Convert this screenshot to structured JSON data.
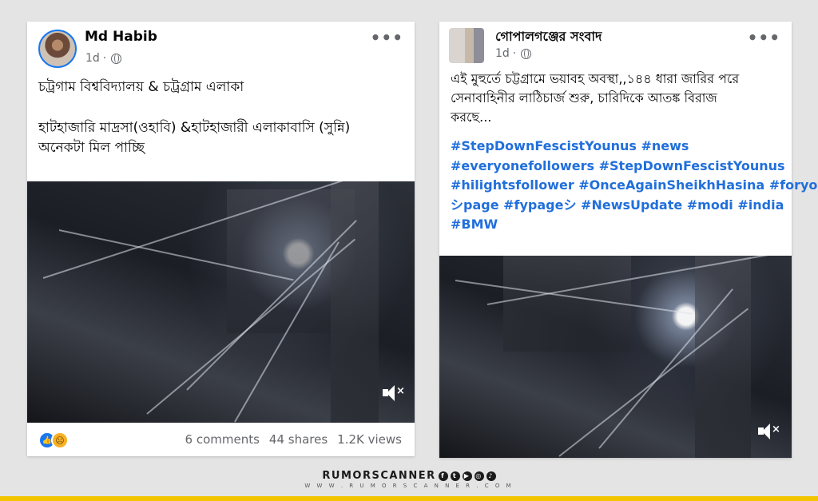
{
  "post1": {
    "author": "Md Habib",
    "time": "1d",
    "more": "•••",
    "text_lines": [
      "চট্রগাম বিশ্ববিদ্যালয় & চট্রগ্রাম এলাকা"
    ],
    "text_lines2": [
      "হাটহাজারি মাদ্রসা(ওহাবি) &হাটহাজারী এলাকাবাসি (সুন্নি)",
      "অনেকটা মিল পাচ্ছি"
    ],
    "comments": "6 comments",
    "shares": "44 shares",
    "views": "1.2K views"
  },
  "post2": {
    "author": "গোপালগঞ্জের সংবাদ",
    "time": "1d",
    "more": "•••",
    "text_lines": [
      "এই মুহুর্তে চট্টগ্রামে ভয়াবহ অবস্থা,,১৪৪ ধারা জারির পরে",
      "সেনাবাহিনীর লাঠিচার্জ শুরু, চারিদিকে আতঙ্ক বিরাজ",
      "করছে..."
    ],
    "hashtag_lines": [
      "#StepDownFescistYounus #news",
      "#everyonefollowers #StepDownFescistYounus",
      "#hilightsfollower #OnceAgainSheikhHasina #foryou",
      "シpage #fypageシ #NewsUpdate #modi #india",
      "#BMW"
    ]
  },
  "brand": {
    "name": "RUMORSCANNER",
    "url": "W W W . R U M O R S C A N N E R . C O M"
  },
  "colors": {
    "accent": "#1877f2",
    "hashtag": "#216fdb",
    "brand_bar": "#f2c500"
  },
  "icons": [
    "globe-icon",
    "more-icon",
    "mute-icon",
    "like-reaction-icon",
    "sad-reaction-icon"
  ]
}
